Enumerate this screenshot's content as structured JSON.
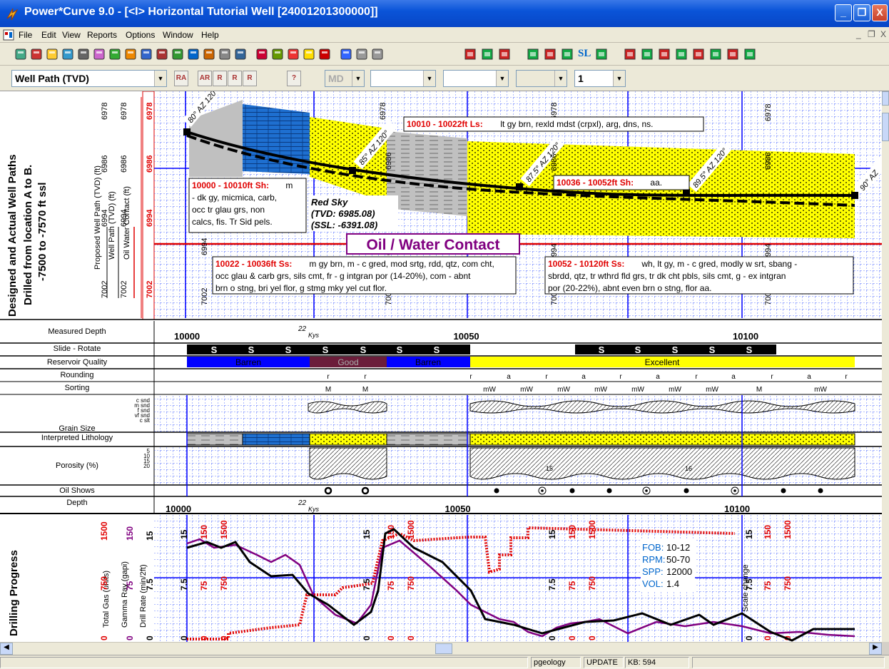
{
  "window": {
    "title": "Power*Curve 9.0 - [<I> Horizontal Tutorial Well [24001201300000]]",
    "minimize_glyph": "_",
    "maximize_glyph": "❐",
    "close_glyph": "X",
    "app_icon": "lightning-icon"
  },
  "menu": {
    "items": [
      "File",
      "Edit",
      "View",
      "Reports",
      "Options",
      "Window",
      "Help"
    ],
    "mdi_min": "_",
    "mdi_restore": "❐",
    "mdi_close": "X"
  },
  "toolbar2": {
    "view_combo": "Well Path (TVD)",
    "md_combo": "MD",
    "combo3": "",
    "combo4": "",
    "combo5": "",
    "scale_combo": "1",
    "btn_labels": [
      "RA",
      "AR",
      "R",
      "R",
      "R",
      "?"
    ]
  },
  "toolbar1": {
    "sl_label": "SL"
  },
  "wellpath": {
    "side_title": [
      "Designed and Actual Well Paths",
      "Drilled from location A to B.",
      "-7500 to -7570 ft ssl"
    ],
    "legend": {
      "proposed": "Proposed Well Path (TVD) (ft)",
      "actual": "Well Path (TVD) (ft)",
      "owc": "Oil Water Contact (ft)"
    },
    "depth_ticks": [
      "6978",
      "6986",
      "6994",
      "7002"
    ],
    "angles": [
      "80° AZ 120°",
      "85° AZ 120°",
      "87.5° AZ 120°",
      "89.5° AZ 120°",
      "90° AZ"
    ],
    "desc1_head": "10000 - 10010ft Sh:",
    "desc1_text": [
      "m",
      "- dk gy, micmica, carb,",
      "occ tr glau grs, non",
      "calcs, fis. Tr Sid pels."
    ],
    "desc2_head": "10010 - 10022ft Ls:",
    "desc2_text": "lt gy brn, rexld mdst (crpxl), arg, dns, ns.",
    "desc3_head": "10022 - 10036ft Ss:",
    "desc3_text": [
      "m gy brn, m - c gred, mod srtg, rdd, qtz, com cht,",
      "occ glau & carb grs, sils cmt, fr - g intgran por (14-20%), com - abnt",
      "brn o stng, bri yel flor, g stmg mky yel cut flor."
    ],
    "desc4_head": "10036 - 10052ft Sh:",
    "desc4_text": "aa.",
    "desc5_head": "10052 - 10120ft Ss:",
    "desc5_text": [
      "wh, lt gy, m - c gred, modly w srt, sbang -",
      "sbrdd, qtz, tr wthrd fld grs, tr dk cht pbls, sils cmt, g - ex intgran",
      "por (20-22%), abnt even brn o stng, flor aa."
    ],
    "red_sky": [
      "Red Sky",
      "(TVD: 6985.08)",
      "(SSL: -6391.08)"
    ],
    "owc_label": "Oil / Water Contact"
  },
  "tracks": {
    "md_label": "Measured Depth",
    "md_ticks": [
      "10000",
      "10050",
      "10100"
    ],
    "marker": "22",
    "marker_sub": "Kys",
    "slide_label": "Slide - Rotate",
    "slide_marks": [
      "S",
      "S",
      "S",
      "S",
      "S",
      "S",
      "S",
      "S",
      "S",
      "S",
      "S",
      "S",
      "S"
    ],
    "rq_label": "Reservoir Quality",
    "rq_values": [
      "Barren",
      "Good",
      "Barren",
      "Excellent"
    ],
    "rounding_label": "Rounding",
    "rounding_marks": [
      "r",
      "r",
      "r",
      "a",
      "r",
      "a",
      "r",
      "a",
      "r",
      "a",
      "r",
      "a",
      "r"
    ],
    "sorting_label": "Sorting",
    "sorting_marks": [
      "M",
      "M",
      "mW",
      "mW",
      "mW",
      "mW",
      "mW",
      "mW",
      "mW",
      "M",
      "mW"
    ],
    "grain_label": "Grain Size",
    "grain_scale": [
      "c snd",
      "m snd",
      "f snd",
      "vf snd",
      "c slt"
    ],
    "lith_label": "Interpreted Lithology",
    "poro_label": "Porosity (%)",
    "poro_scale": [
      "5",
      "10",
      "15",
      "20"
    ],
    "poro_vals": [
      "15",
      "16"
    ],
    "oil_label": "Oil Shows",
    "depth_label": "Depth",
    "depth_ticks": [
      "10000",
      "10050",
      "10100"
    ]
  },
  "drilling": {
    "title": "Drilling Progress",
    "legend_gas": "Total Gas (units)",
    "legend_gr": "Gamma Ray (gapi)",
    "legend_rop": "Drill Rate (min/2ft)",
    "gas_scale": [
      "0",
      "750",
      "1500"
    ],
    "gr_scale": [
      "0",
      "75",
      "150"
    ],
    "rop_scale": [
      "0",
      "7.5",
      "15"
    ],
    "info_labels": [
      "FOB:",
      "RPM:",
      "SPP:",
      "VOL:"
    ],
    "info_values": [
      "10-12",
      "50-70",
      "12000",
      "1.4"
    ],
    "scale_change": "Scale change"
  },
  "status": {
    "user": "pgeology",
    "mode": "UPDATE",
    "kb": "KB: 594"
  },
  "colors": {
    "sand_yellow": "#ffff00",
    "shale_gray": "#c0c0c0",
    "lime_blue": "#1e6fd0",
    "good_maroon": "#6b1d3a",
    "barren_blue": "#0000ff",
    "red": "#e00000",
    "purple": "#800080"
  }
}
